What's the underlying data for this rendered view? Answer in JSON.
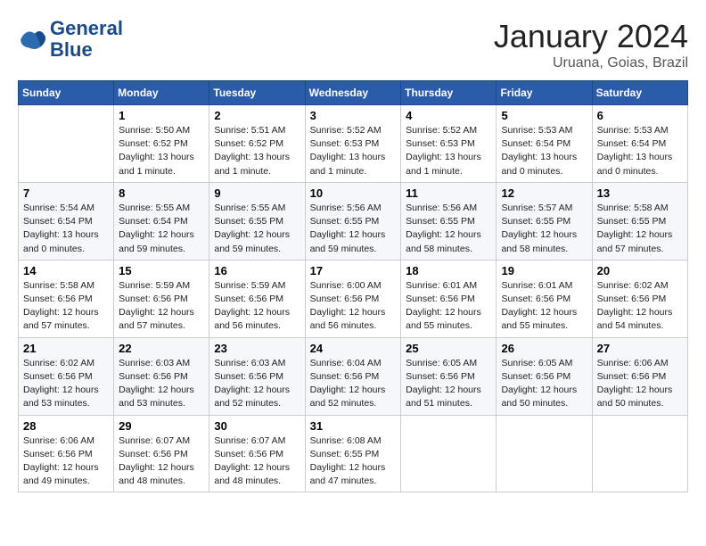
{
  "logo": {
    "line1": "General",
    "line2": "Blue"
  },
  "title": "January 2024",
  "subtitle": "Uruana, Goias, Brazil",
  "weekdays": [
    "Sunday",
    "Monday",
    "Tuesday",
    "Wednesday",
    "Thursday",
    "Friday",
    "Saturday"
  ],
  "weeks": [
    [
      {
        "day": "",
        "info": ""
      },
      {
        "day": "1",
        "info": "Sunrise: 5:50 AM\nSunset: 6:52 PM\nDaylight: 13 hours\nand 1 minute."
      },
      {
        "day": "2",
        "info": "Sunrise: 5:51 AM\nSunset: 6:52 PM\nDaylight: 13 hours\nand 1 minute."
      },
      {
        "day": "3",
        "info": "Sunrise: 5:52 AM\nSunset: 6:53 PM\nDaylight: 13 hours\nand 1 minute."
      },
      {
        "day": "4",
        "info": "Sunrise: 5:52 AM\nSunset: 6:53 PM\nDaylight: 13 hours\nand 1 minute."
      },
      {
        "day": "5",
        "info": "Sunrise: 5:53 AM\nSunset: 6:54 PM\nDaylight: 13 hours\nand 0 minutes."
      },
      {
        "day": "6",
        "info": "Sunrise: 5:53 AM\nSunset: 6:54 PM\nDaylight: 13 hours\nand 0 minutes."
      }
    ],
    [
      {
        "day": "7",
        "info": "Sunrise: 5:54 AM\nSunset: 6:54 PM\nDaylight: 13 hours\nand 0 minutes."
      },
      {
        "day": "8",
        "info": "Sunrise: 5:55 AM\nSunset: 6:54 PM\nDaylight: 12 hours\nand 59 minutes."
      },
      {
        "day": "9",
        "info": "Sunrise: 5:55 AM\nSunset: 6:55 PM\nDaylight: 12 hours\nand 59 minutes."
      },
      {
        "day": "10",
        "info": "Sunrise: 5:56 AM\nSunset: 6:55 PM\nDaylight: 12 hours\nand 59 minutes."
      },
      {
        "day": "11",
        "info": "Sunrise: 5:56 AM\nSunset: 6:55 PM\nDaylight: 12 hours\nand 58 minutes."
      },
      {
        "day": "12",
        "info": "Sunrise: 5:57 AM\nSunset: 6:55 PM\nDaylight: 12 hours\nand 58 minutes."
      },
      {
        "day": "13",
        "info": "Sunrise: 5:58 AM\nSunset: 6:55 PM\nDaylight: 12 hours\nand 57 minutes."
      }
    ],
    [
      {
        "day": "14",
        "info": "Sunrise: 5:58 AM\nSunset: 6:56 PM\nDaylight: 12 hours\nand 57 minutes."
      },
      {
        "day": "15",
        "info": "Sunrise: 5:59 AM\nSunset: 6:56 PM\nDaylight: 12 hours\nand 57 minutes."
      },
      {
        "day": "16",
        "info": "Sunrise: 5:59 AM\nSunset: 6:56 PM\nDaylight: 12 hours\nand 56 minutes."
      },
      {
        "day": "17",
        "info": "Sunrise: 6:00 AM\nSunset: 6:56 PM\nDaylight: 12 hours\nand 56 minutes."
      },
      {
        "day": "18",
        "info": "Sunrise: 6:01 AM\nSunset: 6:56 PM\nDaylight: 12 hours\nand 55 minutes."
      },
      {
        "day": "19",
        "info": "Sunrise: 6:01 AM\nSunset: 6:56 PM\nDaylight: 12 hours\nand 55 minutes."
      },
      {
        "day": "20",
        "info": "Sunrise: 6:02 AM\nSunset: 6:56 PM\nDaylight: 12 hours\nand 54 minutes."
      }
    ],
    [
      {
        "day": "21",
        "info": "Sunrise: 6:02 AM\nSunset: 6:56 PM\nDaylight: 12 hours\nand 53 minutes."
      },
      {
        "day": "22",
        "info": "Sunrise: 6:03 AM\nSunset: 6:56 PM\nDaylight: 12 hours\nand 53 minutes."
      },
      {
        "day": "23",
        "info": "Sunrise: 6:03 AM\nSunset: 6:56 PM\nDaylight: 12 hours\nand 52 minutes."
      },
      {
        "day": "24",
        "info": "Sunrise: 6:04 AM\nSunset: 6:56 PM\nDaylight: 12 hours\nand 52 minutes."
      },
      {
        "day": "25",
        "info": "Sunrise: 6:05 AM\nSunset: 6:56 PM\nDaylight: 12 hours\nand 51 minutes."
      },
      {
        "day": "26",
        "info": "Sunrise: 6:05 AM\nSunset: 6:56 PM\nDaylight: 12 hours\nand 50 minutes."
      },
      {
        "day": "27",
        "info": "Sunrise: 6:06 AM\nSunset: 6:56 PM\nDaylight: 12 hours\nand 50 minutes."
      }
    ],
    [
      {
        "day": "28",
        "info": "Sunrise: 6:06 AM\nSunset: 6:56 PM\nDaylight: 12 hours\nand 49 minutes."
      },
      {
        "day": "29",
        "info": "Sunrise: 6:07 AM\nSunset: 6:56 PM\nDaylight: 12 hours\nand 48 minutes."
      },
      {
        "day": "30",
        "info": "Sunrise: 6:07 AM\nSunset: 6:56 PM\nDaylight: 12 hours\nand 48 minutes."
      },
      {
        "day": "31",
        "info": "Sunrise: 6:08 AM\nSunset: 6:55 PM\nDaylight: 12 hours\nand 47 minutes."
      },
      {
        "day": "",
        "info": ""
      },
      {
        "day": "",
        "info": ""
      },
      {
        "day": "",
        "info": ""
      }
    ]
  ]
}
